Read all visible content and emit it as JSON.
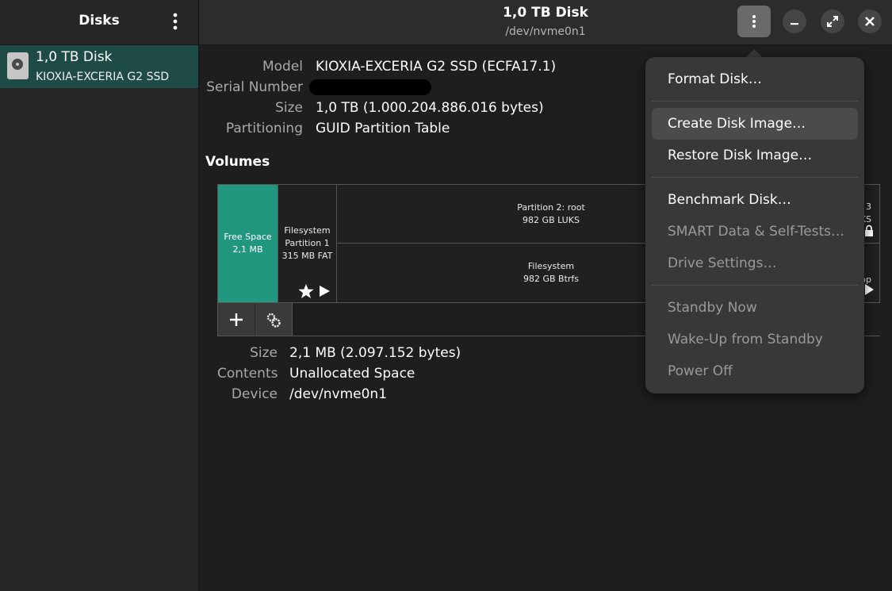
{
  "sidebar": {
    "title": "Disks",
    "menu_icon": "vertical-dots-icon",
    "disks": [
      {
        "name": "1,0 TB Disk",
        "model": "KIOXIA-EXCERIA G2 SSD",
        "icon": "harddisk-icon"
      }
    ]
  },
  "header": {
    "title": "1,0 TB Disk",
    "subtitle": "/dev/nvme0n1"
  },
  "disk_info": {
    "model_label": "Model",
    "model_value": "KIOXIA-EXCERIA G2 SSD (ECFA17.1)",
    "serial_label": "Serial Number",
    "serial_value": "",
    "size_label": "Size",
    "size_value": "1,0 TB (1.000.204.886.016 bytes)",
    "partitioning_label": "Partitioning",
    "partitioning_value": "GUID Partition Table"
  },
  "volumes": {
    "heading": "Volumes",
    "free_space": {
      "title": "Free Space",
      "size": "2,1 MB"
    },
    "partition1": {
      "line1": "Filesystem",
      "line2": "Partition 1",
      "line3": "315 MB FAT"
    },
    "partition2": {
      "line1": "Partition 2: root",
      "line2": "982 GB LUKS"
    },
    "btrfs": {
      "line1": "Filesystem",
      "line2": "982 GB Btrfs"
    },
    "partition3_partial": {
      "line1": "3",
      "line2": "KS",
      "line3": "op"
    }
  },
  "selected_volume": {
    "size_label": "Size",
    "size_value": "2,1 MB (2.097.152 bytes)",
    "contents_label": "Contents",
    "contents_value": "Unallocated Space",
    "device_label": "Device",
    "device_value": "/dev/nvme0n1"
  },
  "menu": {
    "items": [
      {
        "label": "Format Disk…",
        "enabled": true
      },
      {
        "label": "Create Disk Image…",
        "enabled": true,
        "hover": true
      },
      {
        "label": "Restore Disk Image…",
        "enabled": true
      },
      {
        "label": "Benchmark Disk…",
        "enabled": true
      },
      {
        "label": "SMART Data & Self-Tests…",
        "enabled": false
      },
      {
        "label": "Drive Settings…",
        "enabled": false
      },
      {
        "label": "Standby Now",
        "enabled": false
      },
      {
        "label": "Wake-Up from Standby",
        "enabled": false
      },
      {
        "label": "Power Off",
        "enabled": false
      }
    ]
  },
  "colors": {
    "accent_row": "#1f4b46",
    "free_space": "#21977f",
    "menu_bg": "#383838"
  }
}
